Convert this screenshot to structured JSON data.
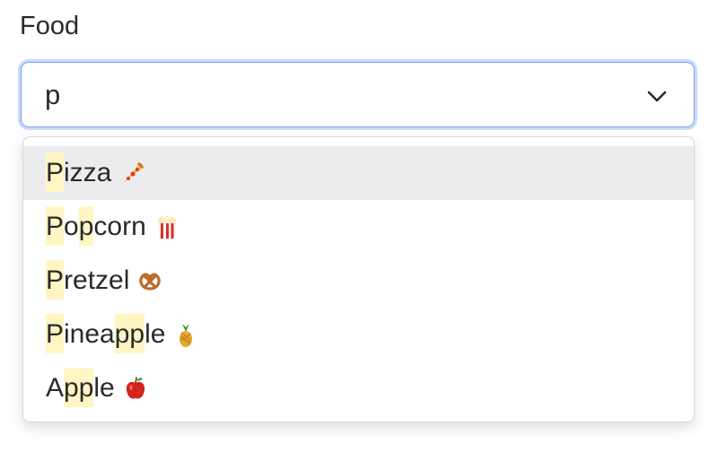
{
  "field": {
    "label": "Food",
    "input_value": "p",
    "toggle_icon": "chevron-down-icon"
  },
  "highlight_color": "#fff6c4",
  "active_color": "#ececef",
  "focus_ring_color": "#c9dafb",
  "options": [
    {
      "segments": [
        {
          "t": "P",
          "hl": true
        },
        {
          "t": "izza",
          "hl": false
        }
      ],
      "icon": "pizza-emoji",
      "active": true
    },
    {
      "segments": [
        {
          "t": "P",
          "hl": true
        },
        {
          "t": "o",
          "hl": false
        },
        {
          "t": "p",
          "hl": true
        },
        {
          "t": "corn",
          "hl": false
        }
      ],
      "icon": "popcorn-emoji",
      "active": false
    },
    {
      "segments": [
        {
          "t": "P",
          "hl": true
        },
        {
          "t": "retzel",
          "hl": false
        }
      ],
      "icon": "pretzel-emoji",
      "active": false
    },
    {
      "segments": [
        {
          "t": "P",
          "hl": true
        },
        {
          "t": "inea",
          "hl": false
        },
        {
          "t": "pp",
          "hl": true
        },
        {
          "t": "le",
          "hl": false
        }
      ],
      "icon": "pineapple-emoji",
      "active": false
    },
    {
      "segments": [
        {
          "t": "A",
          "hl": false
        },
        {
          "t": "pp",
          "hl": true
        },
        {
          "t": "le",
          "hl": false
        }
      ],
      "icon": "apple-emoji",
      "active": false
    }
  ]
}
